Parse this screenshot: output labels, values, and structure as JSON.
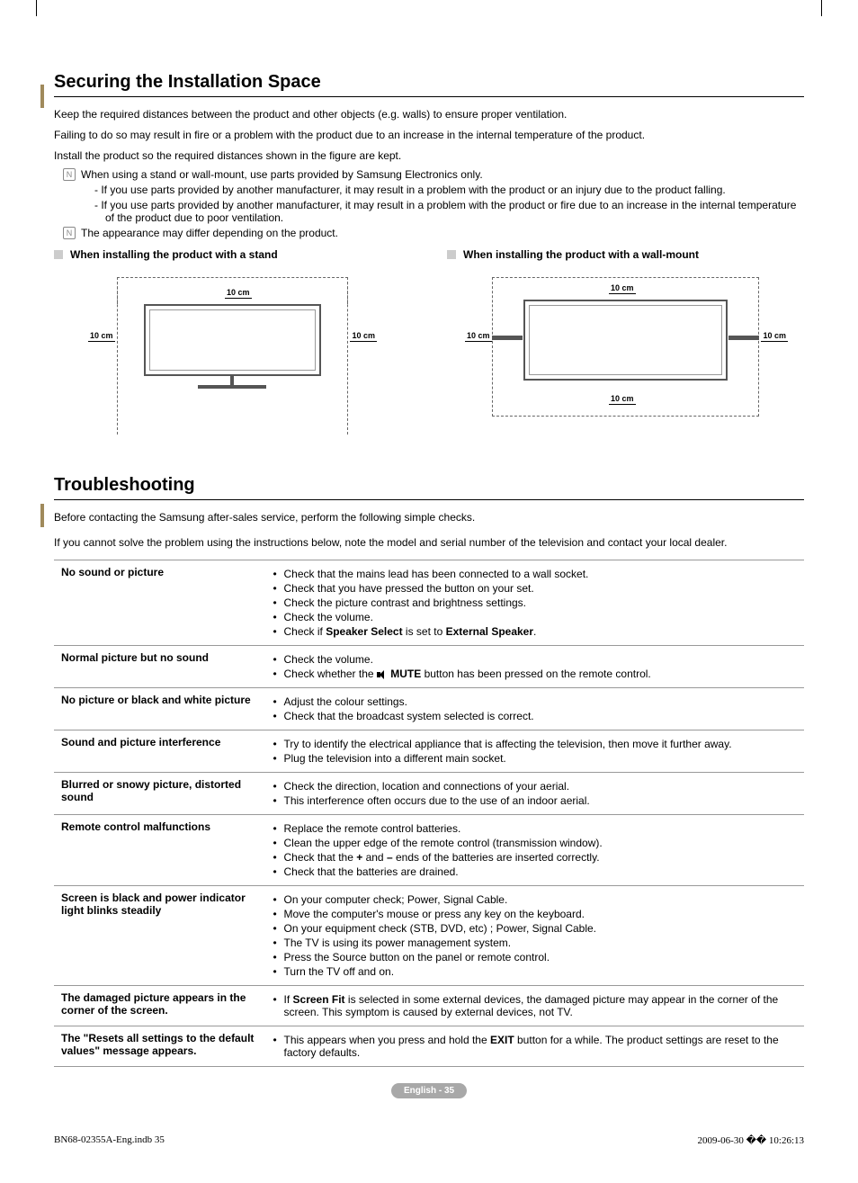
{
  "section1": {
    "title": "Securing the Installation Space",
    "intro1": "Keep the required distances between the product and other objects (e.g. walls) to ensure proper ventilation.",
    "intro2": "Failing to do so may result in fire or a problem with the product due to an increase in the internal temperature of the product.",
    "intro3": "Install the product so the required distances shown in the figure are kept.",
    "note1": "When using a stand or wall-mount, use parts provided by Samsung Electronics only.",
    "note1a": "If you use parts provided by another manufacturer, it may result in a problem with the product or an injury due to the product falling.",
    "note1b": "If you use parts provided by another manufacturer, it may result in a problem with the product or fire due to an increase in the internal temperature of the product due to poor ventilation.",
    "note2": "The appearance may differ depending on the product.",
    "diag1_title": "When installing the product with a stand",
    "diag2_title": "When installing the product with a wall-mount",
    "label_10cm": "10 cm"
  },
  "section2": {
    "title": "Troubleshooting",
    "intro1": "Before contacting the Samsung after-sales service, perform the following simple checks.",
    "intro2": "If you cannot solve the problem using the instructions below, note the model and serial number of the television and contact your local dealer.",
    "rows": [
      {
        "problem": "No sound or picture",
        "items": [
          "Check that the mains lead has been connected to a wall socket.",
          "Check that you have pressed the button on your set.",
          "Check the picture contrast and brightness settings.",
          "Check the volume."
        ],
        "last_html": "Check if <b>Speaker Select</b> is set to <b>External Speaker</b>."
      },
      {
        "problem": "Normal picture but no sound",
        "items": [
          "Check the volume."
        ],
        "last_html": "Check whether the <span class='mute-icon' data-name='mute-icon' data-interactable='false'></span> <b>MUTE</b> button has been pressed on the remote control."
      },
      {
        "problem": "No picture or black and white picture",
        "items": [
          "Adjust the colour settings.",
          "Check that the broadcast system selected is correct."
        ]
      },
      {
        "problem": "Sound and picture interference",
        "items": [
          "Try to identify the electrical appliance that is affecting the television, then move it further away.",
          "Plug the television into a different main socket."
        ]
      },
      {
        "problem": "Blurred or snowy picture, distorted sound",
        "items": [
          "Check the direction, location and connections of your aerial.",
          "This interference often occurs due to the use of an indoor aerial."
        ]
      },
      {
        "problem": "Remote control malfunctions",
        "items": [
          "Replace the remote control batteries.",
          "Clean the upper edge of the remote control (transmission window)."
        ],
        "mid_html": "Check that the <b>+</b> and <b>–</b> ends of the batteries are inserted correctly.",
        "items2": [
          "Check that the batteries are drained."
        ]
      },
      {
        "problem": "Screen is black and power indicator light blinks steadily",
        "items": [
          "On your computer check; Power, Signal Cable.",
          "Move the computer's mouse or press any key on the keyboard.",
          "On your equipment check (STB, DVD, etc) ; Power, Signal Cable.",
          "The TV is using its power management system.",
          "Press the Source button on the panel or remote control.",
          "Turn the TV off and on."
        ]
      },
      {
        "problem": "The damaged picture appears in the corner of the screen.",
        "last_html": "If <b>Screen Fit</b> is selected in some external devices, the damaged picture may appear in the corner of the screen. This symptom is caused by external devices, not TV."
      },
      {
        "problem": "The \"Resets all settings to the default values\" message appears.",
        "last_html": "This appears when you press and hold the <b>EXIT</b> button for a while. The product settings are reset to the factory defaults."
      }
    ]
  },
  "page_label": "English - 35",
  "footer_left": "BN68-02355A-Eng.indb   35",
  "footer_right": "2009-06-30   �� 10:26:13"
}
